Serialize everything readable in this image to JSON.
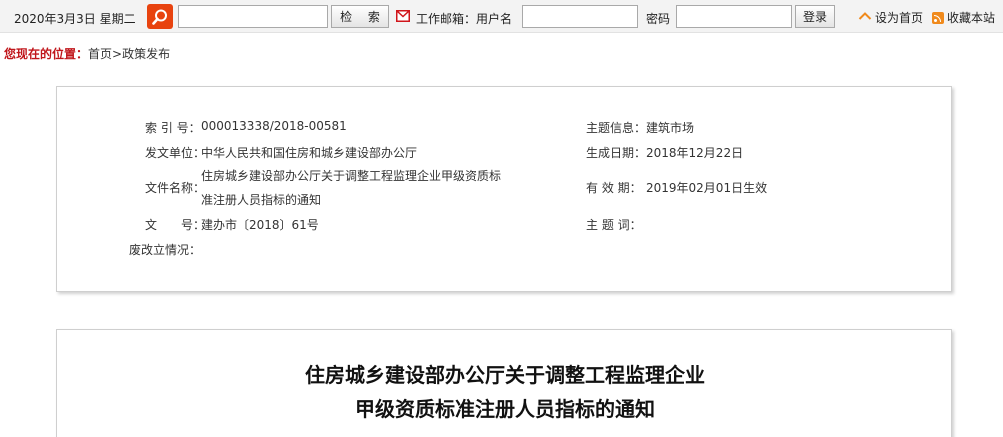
{
  "topbar": {
    "date": "2020年3月3日 星期二",
    "search_value": "",
    "search_button": "检 索",
    "mail_label": "工作邮箱：用户名",
    "username_value": "",
    "password_label": "密码",
    "password_value": "",
    "login_button": "登录",
    "set_home": "设为首页",
    "favorite": "收藏本站",
    "accent_color": "#e8430f"
  },
  "breadcrumb": {
    "label": "您现在的位置：",
    "path": "首页>政策发布"
  },
  "info": {
    "index_label": "索 引 号：",
    "index_value": "000013338/2018-00581",
    "issuer_label": "发文单位：",
    "issuer_value": "中华人民共和国住房和城乡建设部办公厅",
    "filename_label": "文件名称：",
    "filename_line1": "住房城乡建设部办公厅关于调整工程监理企业甲级资质标",
    "filename_line2": "准注册人员指标的通知",
    "docno_label": "文　　号：",
    "docno_value": "建办市〔2018〕61号",
    "status_label": "废改立情况：",
    "status_value": "",
    "topic_label": "主题信息：",
    "topic_value": "建筑市场",
    "created_label": "生成日期：",
    "created_value": "2018年12月22日",
    "valid_label": "有 效 期：",
    "valid_value": "2019年02月01日生效",
    "keywords_label": "主 题 词：",
    "keywords_value": ""
  },
  "document": {
    "title_line1": "住房城乡建设部办公厅关于调整工程监理企业",
    "title_line2": "甲级资质标准注册人员指标的通知"
  }
}
